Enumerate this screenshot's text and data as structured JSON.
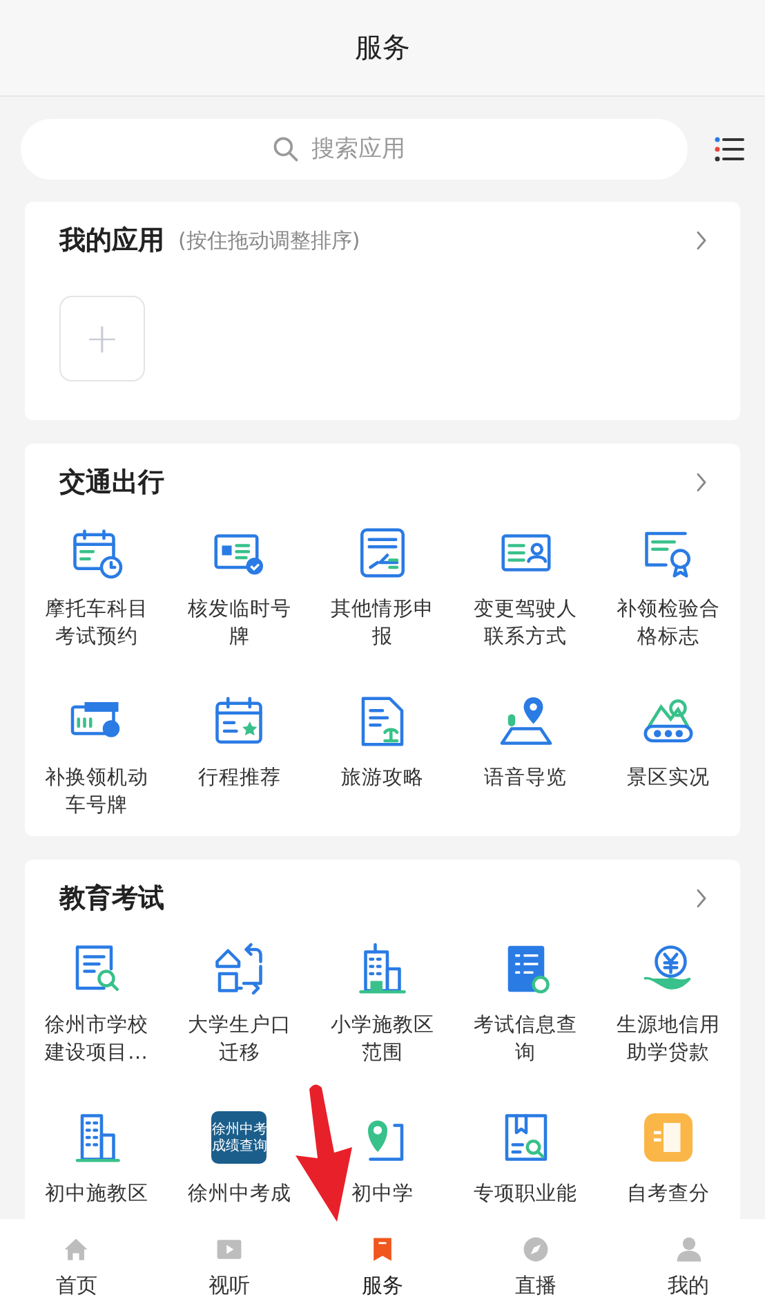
{
  "header": {
    "title": "服务"
  },
  "search": {
    "placeholder": "搜索应用"
  },
  "my_apps": {
    "title": "我的应用",
    "hint": "(按住拖动调整排序)",
    "add_label": "+"
  },
  "sections": [
    {
      "title": "交通出行",
      "items": [
        {
          "label": "摩托车科目考试预约"
        },
        {
          "label": "核发临时号牌"
        },
        {
          "label": "其他情形申报"
        },
        {
          "label": "变更驾驶人联系方式"
        },
        {
          "label": "补领检验合格标志"
        },
        {
          "label": "补换领机动车号牌"
        },
        {
          "label": "行程推荐"
        },
        {
          "label": "旅游攻略"
        },
        {
          "label": "语音导览"
        },
        {
          "label": "景区实况"
        }
      ]
    },
    {
      "title": "教育考试",
      "items": [
        {
          "label": "徐州市学校建设项目…"
        },
        {
          "label": "大学生户口迁移"
        },
        {
          "label": "小学施教区范围"
        },
        {
          "label": "考试信息查询"
        },
        {
          "label": "生源地信用助学贷款"
        },
        {
          "label": "初中施教区"
        },
        {
          "label": "徐州中考成",
          "icon_text": [
            "徐州中考",
            "成绩查询"
          ]
        },
        {
          "label": "初中学"
        },
        {
          "label": "专项职业能"
        },
        {
          "label": "自考查分"
        }
      ]
    }
  ],
  "tabs": [
    {
      "label": "首页",
      "selected": false
    },
    {
      "label": "视听",
      "selected": false
    },
    {
      "label": "服务",
      "selected": true
    },
    {
      "label": "直播",
      "selected": false
    },
    {
      "label": "我的",
      "selected": false
    }
  ],
  "annotations": [
    {
      "kind": "arrow"
    }
  ]
}
